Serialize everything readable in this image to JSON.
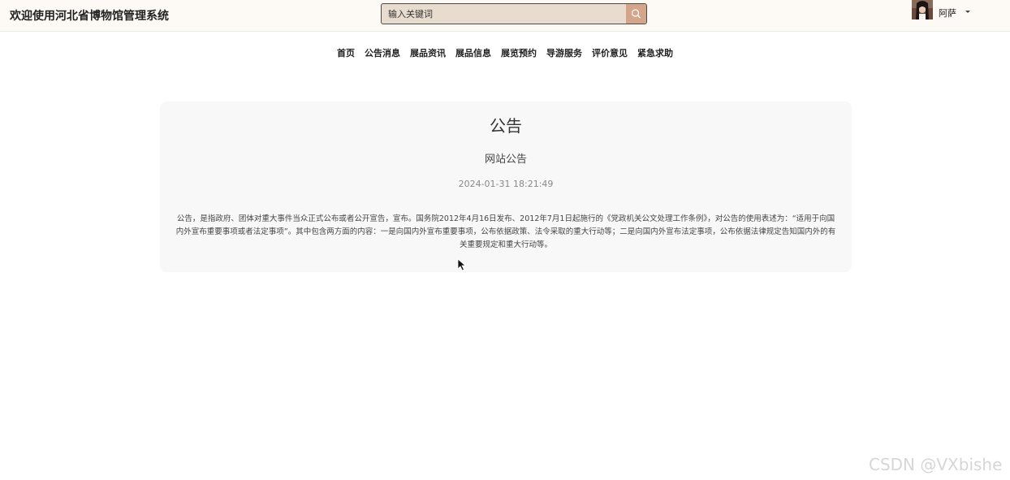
{
  "header": {
    "site_title": "欢迎使用河北省博物馆管理系统",
    "search": {
      "placeholder": "输入关键词",
      "icon": "search-icon"
    },
    "user": {
      "name": "阿萨",
      "avatar": "user-avatar",
      "dropdown_icon": "caret-down-icon"
    }
  },
  "nav": {
    "items": [
      {
        "label": "首页"
      },
      {
        "label": "公告消息"
      },
      {
        "label": "展品资讯"
      },
      {
        "label": "展品信息"
      },
      {
        "label": "展览预约"
      },
      {
        "label": "导游服务"
      },
      {
        "label": "评价意见"
      },
      {
        "label": "紧急求助"
      }
    ]
  },
  "notice": {
    "heading": "公告",
    "title": "网站公告",
    "date": "2024-01-31 18:21:49",
    "body": "公告，是指政府、团体对重大事件当众正式公布或者公开宣告，宣布。国务院2012年4月16日发布、2012年7月1日起施行的《党政机关公文处理工作条例》，对公告的使用表述为：“适用于向国内外宣布重要事项或者法定事项”。其中包含两方面的内容：一是向国内外宣布重要事项，公布依据政策、法令采取的重大行动等；二是向国内外宣布法定事项，公布依据法律规定告知国内外的有关重要规定和重大行动等。"
  },
  "watermark": "CSDN @VXbishe",
  "colors": {
    "topbar_bg": "#fdfaf6",
    "search_bg": "#e8dccf",
    "search_button": "#d4a58a",
    "card_bg": "#f8f8f8"
  }
}
